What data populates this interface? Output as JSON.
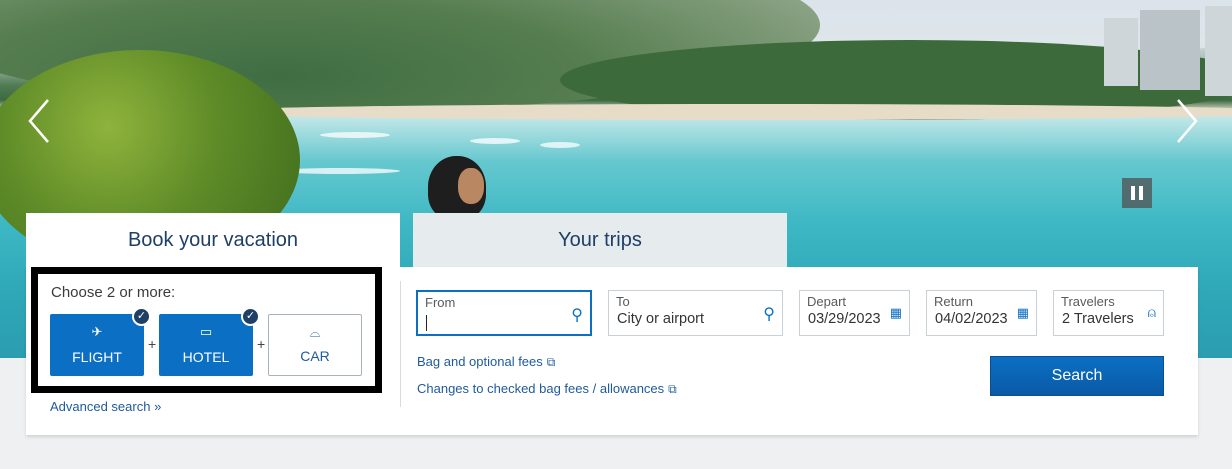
{
  "hero": {
    "prev_icon": "chevron-left-icon",
    "next_icon": "chevron-right-icon",
    "pause_icon": "pause-icon"
  },
  "tabs": [
    {
      "label": "Book your vacation",
      "active": true
    },
    {
      "label": "Your trips",
      "active": false
    }
  ],
  "vacation": {
    "choose_label": "Choose 2 or more:",
    "products": [
      {
        "label": "FLIGHT",
        "icon": "plane-icon",
        "selected": true
      },
      {
        "label": "HOTEL",
        "icon": "bed-icon",
        "selected": true
      },
      {
        "label": "CAR",
        "icon": "car-icon",
        "selected": false
      }
    ],
    "plus": "+",
    "advanced_search": "Advanced search  »"
  },
  "search": {
    "from": {
      "label": "From",
      "value": ""
    },
    "to": {
      "label": "To",
      "value": "City or airport"
    },
    "depart": {
      "label": "Depart",
      "value": "03/29/2023"
    },
    "return": {
      "label": "Return",
      "value": "04/02/2023"
    },
    "travelers": {
      "label": "Travelers",
      "value": "2 Travelers"
    },
    "bag_link": "Bag and optional fees",
    "changes_link": "Changes to checked bag fees / allowances",
    "button": "Search"
  },
  "colors": {
    "accent": "#0b6fc4",
    "navy": "#1e3f66",
    "link": "#1e5a9c"
  }
}
